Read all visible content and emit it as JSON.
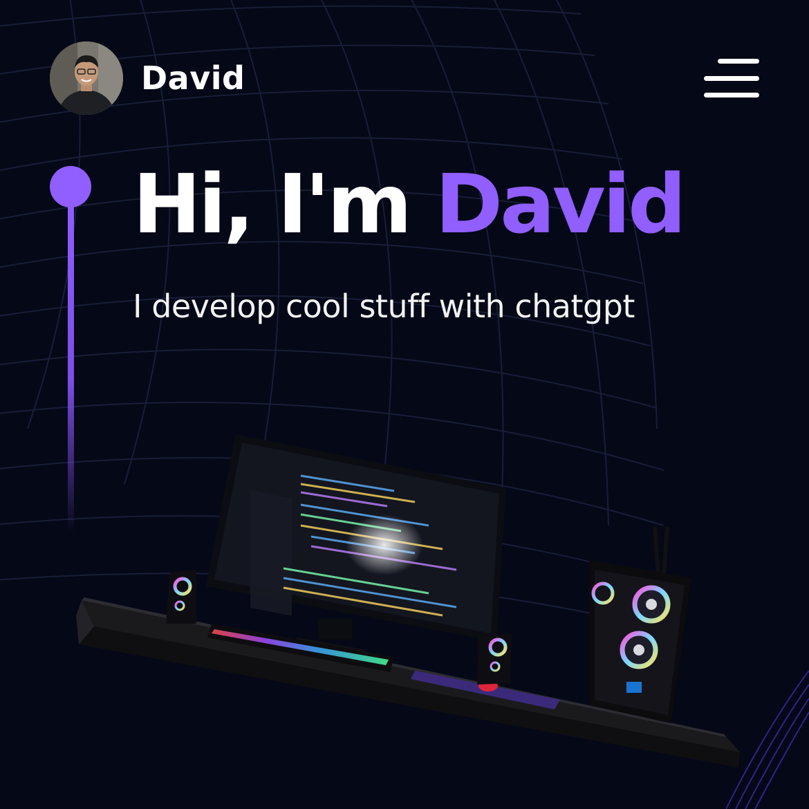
{
  "navbar": {
    "brand_name": "David",
    "avatar_alt": "David profile photo",
    "menu_icon": "hamburger-menu-icon"
  },
  "hero": {
    "greeting": "Hi, I'm ",
    "name": "David",
    "subtitle": "I develop cool stuff with chatgpt"
  },
  "scene": {
    "description_icon": "computer-desk-3d-model"
  },
  "colors": {
    "background": "#050816",
    "accent": "#915eff",
    "text": "#ffffff"
  }
}
